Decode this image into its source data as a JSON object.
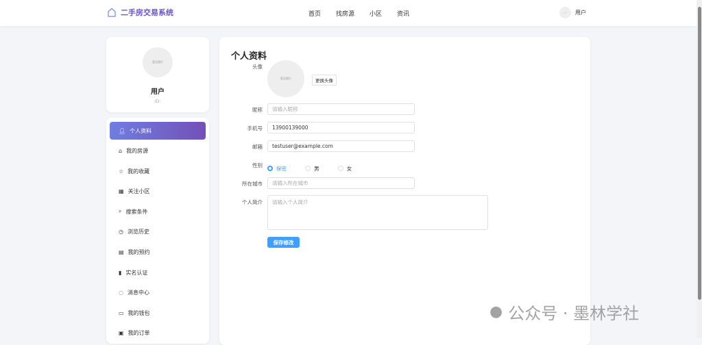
{
  "header": {
    "brand": "二手房交易系统",
    "nav": [
      "首页",
      "找房源",
      "小区",
      "资讯"
    ],
    "user_avatar_text": "--",
    "user_name": "用户"
  },
  "profile_card": {
    "avatar_text": "暂无图片",
    "name": "用户",
    "id_label": "ID:"
  },
  "sidebar": {
    "items": [
      "个人资料",
      "我的房源",
      "我的收藏",
      "关注小区",
      "搜索条件",
      "浏览历史",
      "我的预约",
      "实名认证",
      "消息中心",
      "我的钱包",
      "我的订单"
    ]
  },
  "form": {
    "title": "个人资料",
    "avatar_label": "头像",
    "avatar_text": "暂无图片",
    "change_avatar": "更换头像",
    "nickname_label": "昵称",
    "nickname_placeholder": "请输入昵称",
    "phone_label": "手机号",
    "phone_value": "13900139000",
    "email_label": "邮箱",
    "email_value": "testuser@example.com",
    "gender_label": "性别",
    "gender_options": [
      "保密",
      "男",
      "女"
    ],
    "city_label": "所在城市",
    "city_placeholder": "请输入所在城市",
    "bio_label": "个人简介",
    "bio_placeholder": "请输入个人简介",
    "save": "保存修改"
  },
  "watermark": {
    "text": "公众号 · 墨林学社"
  },
  "colors": {
    "brand": "#6a55c8",
    "primary": "#409eff"
  }
}
